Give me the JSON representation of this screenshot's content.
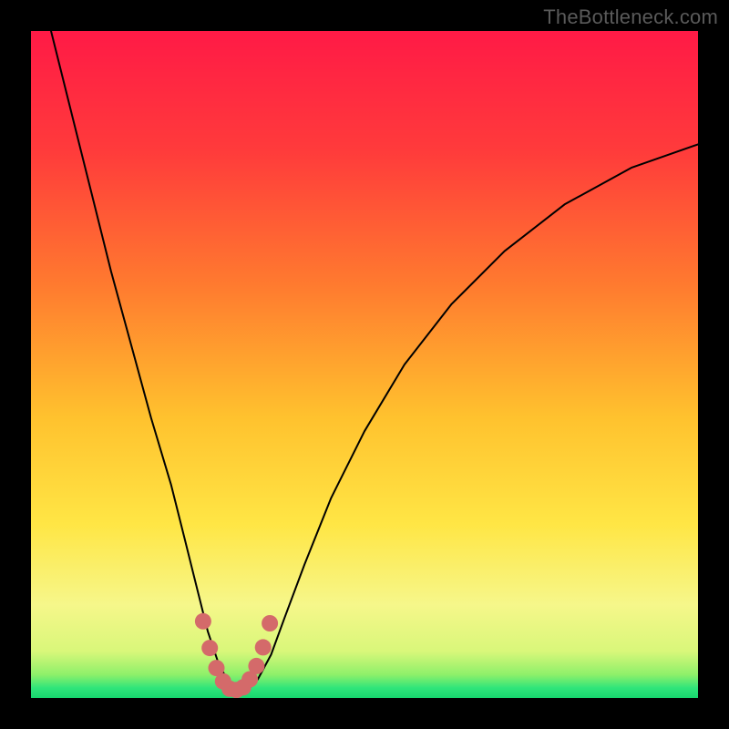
{
  "watermark": "TheBottleneck.com",
  "colors": {
    "frame": "#000000",
    "gradient_stops": [
      {
        "pos": 0.0,
        "color": "#ff1a46"
      },
      {
        "pos": 0.18,
        "color": "#ff3b3b"
      },
      {
        "pos": 0.38,
        "color": "#ff7a2f"
      },
      {
        "pos": 0.58,
        "color": "#ffc22e"
      },
      {
        "pos": 0.74,
        "color": "#ffe645"
      },
      {
        "pos": 0.86,
        "color": "#f6f78a"
      },
      {
        "pos": 0.93,
        "color": "#d9f77a"
      },
      {
        "pos": 0.965,
        "color": "#8ef06a"
      },
      {
        "pos": 0.985,
        "color": "#2fe57a"
      },
      {
        "pos": 1.0,
        "color": "#17d66e"
      }
    ],
    "curve": "#000000",
    "marker_fill": "#d46a6a",
    "marker_stroke": "#b85050"
  },
  "chart_data": {
    "type": "line",
    "title": "",
    "xlabel": "",
    "ylabel": "",
    "xlim": [
      0,
      100
    ],
    "ylim": [
      0,
      100
    ],
    "note": "Axes are unlabeled; values are pixel-normalized 0–100. y=0 is the bottom (green) edge, x=0 is the left edge.",
    "series": [
      {
        "name": "curve",
        "x": [
          3,
          6,
          9,
          12,
          15,
          18,
          21,
          23,
          25,
          26.5,
          28,
          29.5,
          31,
          32.5,
          34,
          36,
          38,
          41,
          45,
          50,
          56,
          63,
          71,
          80,
          90,
          100
        ],
        "y": [
          100,
          88,
          76,
          64,
          53,
          42,
          32,
          24,
          16,
          10,
          5.5,
          2.5,
          1.2,
          1.2,
          2.8,
          6.5,
          12,
          20,
          30,
          40,
          50,
          59,
          67,
          74,
          79.5,
          83
        ]
      }
    ],
    "markers": {
      "name": "highlighted-points",
      "x": [
        25.8,
        26.8,
        27.8,
        28.8,
        29.8,
        30.8,
        31.8,
        32.8,
        33.8,
        34.8,
        35.8
      ],
      "y": [
        11.5,
        7.5,
        4.5,
        2.5,
        1.4,
        1.2,
        1.6,
        2.8,
        4.8,
        7.6,
        11.2
      ]
    }
  }
}
